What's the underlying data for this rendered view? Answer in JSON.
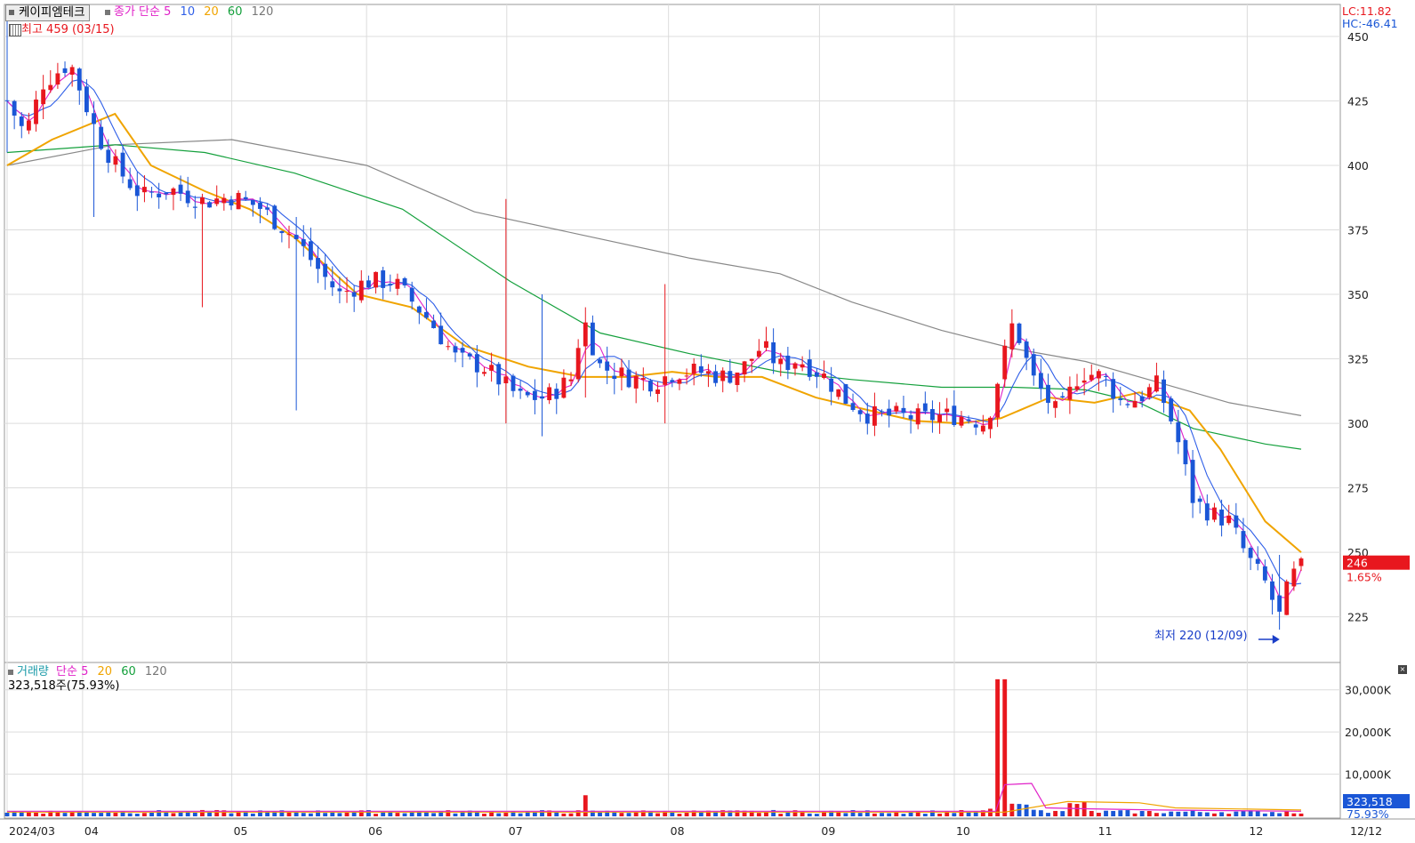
{
  "header": {
    "stock_name": "케이피엠테크",
    "ma_label": "종가 단순",
    "ma_periods": [
      "5",
      "10",
      "20",
      "60",
      "120"
    ],
    "high_label": "최고 459 (03/15)",
    "lc": "LC:11.82",
    "hc": "HC:-46.41"
  },
  "volume_header": {
    "label": "거래량",
    "ma_label": "단순",
    "ma_periods": [
      "5",
      "20",
      "60",
      "120"
    ],
    "value": "323,518주(75.93%)"
  },
  "price_axis": {
    "ticks": [
      "450",
      "425",
      "400",
      "375",
      "350",
      "325",
      "300",
      "275",
      "250",
      "225"
    ],
    "current_price": "246",
    "current_change": "1.65%"
  },
  "volume_axis": {
    "ticks": [
      "30,000K",
      "20,000K",
      "10,000K"
    ],
    "current_volume": "323,518",
    "current_pct": "75.93%"
  },
  "date_axis": [
    "2024/03",
    "04",
    "05",
    "06",
    "07",
    "08",
    "09",
    "10",
    "11",
    "12"
  ],
  "date_axis_end": "12/12",
  "annotation_low": "최저 220 (12/09)",
  "colors": {
    "up": "#e8171e",
    "down": "#1a56d6",
    "ma5": "#e020c8",
    "ma10": "#2f5fe8",
    "ma20": "#f0a400",
    "ma60": "#14a03c",
    "ma120": "#888888"
  },
  "chart_data": {
    "type": "candlestick",
    "price_range": [
      209,
      460
    ],
    "volume_range": [
      0,
      35000
    ],
    "grid": true,
    "ma_lines": {
      "ma20": [
        [
          0,
          400
        ],
        [
          25,
          410
        ],
        [
          60,
          420
        ],
        [
          80,
          400
        ],
        [
          110,
          390
        ],
        [
          135,
          383
        ],
        [
          160,
          372
        ],
        [
          195,
          350
        ],
        [
          225,
          345
        ],
        [
          255,
          330
        ],
        [
          290,
          322
        ],
        [
          320,
          318
        ],
        [
          345,
          318
        ],
        [
          370,
          320
        ],
        [
          395,
          318
        ],
        [
          420,
          318
        ],
        [
          450,
          310
        ],
        [
          480,
          305
        ],
        [
          505,
          301
        ],
        [
          530,
          300
        ],
        [
          553,
          302
        ],
        [
          580,
          310
        ],
        [
          605,
          308
        ],
        [
          630,
          312
        ],
        [
          658,
          305
        ],
        [
          675,
          290
        ],
        [
          700,
          262
        ],
        [
          720,
          250
        ]
      ],
      "ma60": [
        [
          0,
          405
        ],
        [
          60,
          408
        ],
        [
          110,
          405
        ],
        [
          160,
          397
        ],
        [
          220,
          383
        ],
        [
          280,
          355
        ],
        [
          330,
          335
        ],
        [
          380,
          327
        ],
        [
          430,
          320
        ],
        [
          470,
          317
        ],
        [
          520,
          314
        ],
        [
          560,
          314
        ],
        [
          600,
          313
        ],
        [
          630,
          308
        ],
        [
          660,
          298
        ],
        [
          700,
          292
        ],
        [
          720,
          290
        ]
      ],
      "ma120": [
        [
          0,
          400
        ],
        [
          60,
          408
        ],
        [
          125,
          410
        ],
        [
          200,
          400
        ],
        [
          260,
          382
        ],
        [
          320,
          373
        ],
        [
          380,
          364
        ],
        [
          430,
          358
        ],
        [
          470,
          347
        ],
        [
          520,
          336
        ],
        [
          560,
          329
        ],
        [
          600,
          324
        ],
        [
          640,
          316
        ],
        [
          680,
          308
        ],
        [
          720,
          303
        ]
      ]
    },
    "volume_ma": {
      "ma5": [
        [
          0,
          1.2
        ],
        [
          550,
          1.2
        ],
        [
          555,
          7.5
        ],
        [
          570,
          7.8
        ],
        [
          578,
          2
        ],
        [
          600,
          1.8
        ],
        [
          640,
          1.5
        ],
        [
          720,
          1.2
        ]
      ],
      "ma20": [
        [
          0,
          1
        ],
        [
          555,
          1
        ],
        [
          590,
          3.5
        ],
        [
          630,
          3.2
        ],
        [
          650,
          2
        ],
        [
          720,
          1.5
        ]
      ]
    },
    "low_point": {
      "t": 710,
      "price": 220
    },
    "high_point": {
      "t": 0,
      "price": 459
    }
  }
}
